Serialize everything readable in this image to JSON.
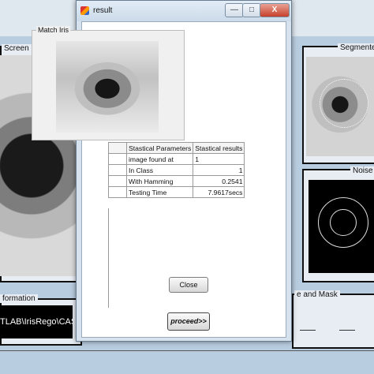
{
  "background_app": {
    "panels": {
      "screen_title": "Screen",
      "segmented_title": "Segmente",
      "noise_title": "Noise",
      "information_title": "formation",
      "mask_title": "e and Mask"
    },
    "path_text": "TLAB\\IrisRego\\CASIA"
  },
  "dialog": {
    "title": "result",
    "controls": {
      "minimize": "—",
      "maximize": "□",
      "close": "X"
    },
    "group_title": "Match Iris",
    "table": {
      "headers": [
        "",
        "Stastical Parameters",
        "Stastical results"
      ],
      "rows": [
        {
          "param": "image found at",
          "value": "1"
        },
        {
          "param": "In Class",
          "value": "1"
        },
        {
          "param": "With Hamming",
          "value": "0.2541"
        },
        {
          "param": "Testing Time",
          "value": "7.9617secs"
        }
      ]
    },
    "close_label": "Close"
  },
  "proceed_label": "proceed>>"
}
